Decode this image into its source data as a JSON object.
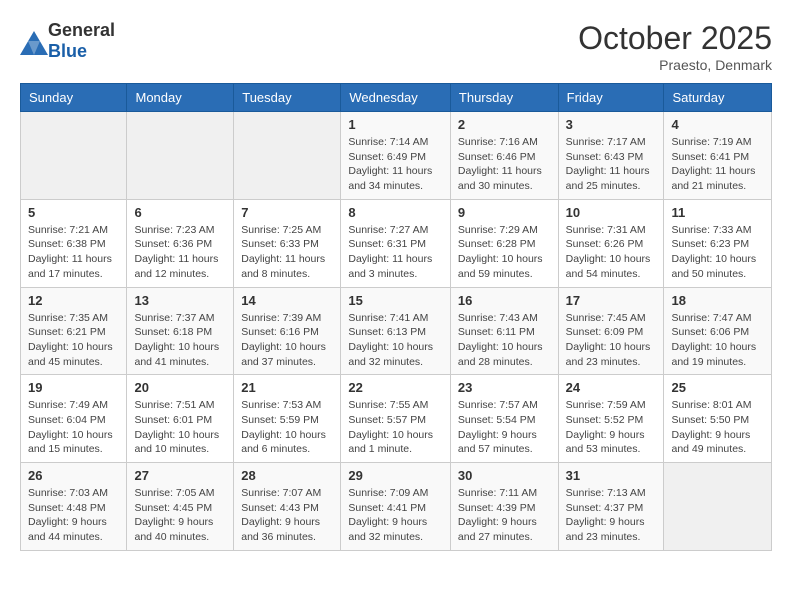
{
  "header": {
    "logo_general": "General",
    "logo_blue": "Blue",
    "month_title": "October 2025",
    "location": "Praesto, Denmark"
  },
  "days_of_week": [
    "Sunday",
    "Monday",
    "Tuesday",
    "Wednesday",
    "Thursday",
    "Friday",
    "Saturday"
  ],
  "weeks": [
    {
      "days": [
        {
          "number": "",
          "info": ""
        },
        {
          "number": "",
          "info": ""
        },
        {
          "number": "",
          "info": ""
        },
        {
          "number": "1",
          "info": "Sunrise: 7:14 AM\nSunset: 6:49 PM\nDaylight: 11 hours\nand 34 minutes."
        },
        {
          "number": "2",
          "info": "Sunrise: 7:16 AM\nSunset: 6:46 PM\nDaylight: 11 hours\nand 30 minutes."
        },
        {
          "number": "3",
          "info": "Sunrise: 7:17 AM\nSunset: 6:43 PM\nDaylight: 11 hours\nand 25 minutes."
        },
        {
          "number": "4",
          "info": "Sunrise: 7:19 AM\nSunset: 6:41 PM\nDaylight: 11 hours\nand 21 minutes."
        }
      ]
    },
    {
      "days": [
        {
          "number": "5",
          "info": "Sunrise: 7:21 AM\nSunset: 6:38 PM\nDaylight: 11 hours\nand 17 minutes."
        },
        {
          "number": "6",
          "info": "Sunrise: 7:23 AM\nSunset: 6:36 PM\nDaylight: 11 hours\nand 12 minutes."
        },
        {
          "number": "7",
          "info": "Sunrise: 7:25 AM\nSunset: 6:33 PM\nDaylight: 11 hours\nand 8 minutes."
        },
        {
          "number": "8",
          "info": "Sunrise: 7:27 AM\nSunset: 6:31 PM\nDaylight: 11 hours\nand 3 minutes."
        },
        {
          "number": "9",
          "info": "Sunrise: 7:29 AM\nSunset: 6:28 PM\nDaylight: 10 hours\nand 59 minutes."
        },
        {
          "number": "10",
          "info": "Sunrise: 7:31 AM\nSunset: 6:26 PM\nDaylight: 10 hours\nand 54 minutes."
        },
        {
          "number": "11",
          "info": "Sunrise: 7:33 AM\nSunset: 6:23 PM\nDaylight: 10 hours\nand 50 minutes."
        }
      ]
    },
    {
      "days": [
        {
          "number": "12",
          "info": "Sunrise: 7:35 AM\nSunset: 6:21 PM\nDaylight: 10 hours\nand 45 minutes."
        },
        {
          "number": "13",
          "info": "Sunrise: 7:37 AM\nSunset: 6:18 PM\nDaylight: 10 hours\nand 41 minutes."
        },
        {
          "number": "14",
          "info": "Sunrise: 7:39 AM\nSunset: 6:16 PM\nDaylight: 10 hours\nand 37 minutes."
        },
        {
          "number": "15",
          "info": "Sunrise: 7:41 AM\nSunset: 6:13 PM\nDaylight: 10 hours\nand 32 minutes."
        },
        {
          "number": "16",
          "info": "Sunrise: 7:43 AM\nSunset: 6:11 PM\nDaylight: 10 hours\nand 28 minutes."
        },
        {
          "number": "17",
          "info": "Sunrise: 7:45 AM\nSunset: 6:09 PM\nDaylight: 10 hours\nand 23 minutes."
        },
        {
          "number": "18",
          "info": "Sunrise: 7:47 AM\nSunset: 6:06 PM\nDaylight: 10 hours\nand 19 minutes."
        }
      ]
    },
    {
      "days": [
        {
          "number": "19",
          "info": "Sunrise: 7:49 AM\nSunset: 6:04 PM\nDaylight: 10 hours\nand 15 minutes."
        },
        {
          "number": "20",
          "info": "Sunrise: 7:51 AM\nSunset: 6:01 PM\nDaylight: 10 hours\nand 10 minutes."
        },
        {
          "number": "21",
          "info": "Sunrise: 7:53 AM\nSunset: 5:59 PM\nDaylight: 10 hours\nand 6 minutes."
        },
        {
          "number": "22",
          "info": "Sunrise: 7:55 AM\nSunset: 5:57 PM\nDaylight: 10 hours\nand 1 minute."
        },
        {
          "number": "23",
          "info": "Sunrise: 7:57 AM\nSunset: 5:54 PM\nDaylight: 9 hours\nand 57 minutes."
        },
        {
          "number": "24",
          "info": "Sunrise: 7:59 AM\nSunset: 5:52 PM\nDaylight: 9 hours\nand 53 minutes."
        },
        {
          "number": "25",
          "info": "Sunrise: 8:01 AM\nSunset: 5:50 PM\nDaylight: 9 hours\nand 49 minutes."
        }
      ]
    },
    {
      "days": [
        {
          "number": "26",
          "info": "Sunrise: 7:03 AM\nSunset: 4:48 PM\nDaylight: 9 hours\nand 44 minutes."
        },
        {
          "number": "27",
          "info": "Sunrise: 7:05 AM\nSunset: 4:45 PM\nDaylight: 9 hours\nand 40 minutes."
        },
        {
          "number": "28",
          "info": "Sunrise: 7:07 AM\nSunset: 4:43 PM\nDaylight: 9 hours\nand 36 minutes."
        },
        {
          "number": "29",
          "info": "Sunrise: 7:09 AM\nSunset: 4:41 PM\nDaylight: 9 hours\nand 32 minutes."
        },
        {
          "number": "30",
          "info": "Sunrise: 7:11 AM\nSunset: 4:39 PM\nDaylight: 9 hours\nand 27 minutes."
        },
        {
          "number": "31",
          "info": "Sunrise: 7:13 AM\nSunset: 4:37 PM\nDaylight: 9 hours\nand 23 minutes."
        },
        {
          "number": "",
          "info": ""
        }
      ]
    }
  ]
}
